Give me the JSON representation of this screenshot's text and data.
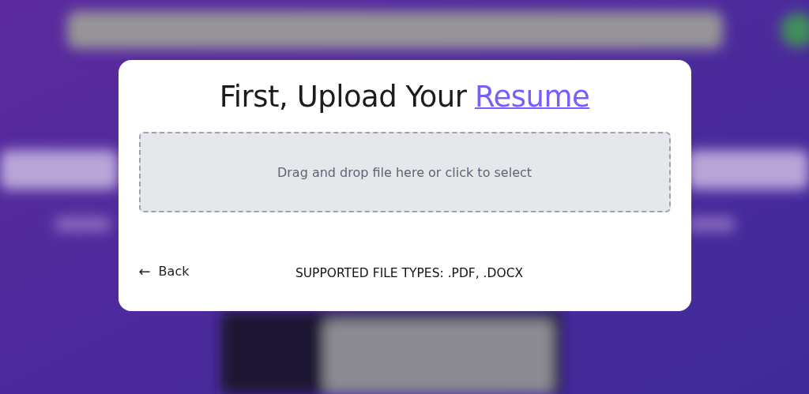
{
  "dialog": {
    "title": {
      "text": "First, Upload Your",
      "link": "Resume"
    },
    "dropzone": {
      "prompt": "Drag and drop file here or click to select"
    },
    "back": {
      "icon": "←",
      "label": "Back"
    },
    "supported_types": "SUPPORTED FILE TYPES: .PDF, .DOCX"
  }
}
